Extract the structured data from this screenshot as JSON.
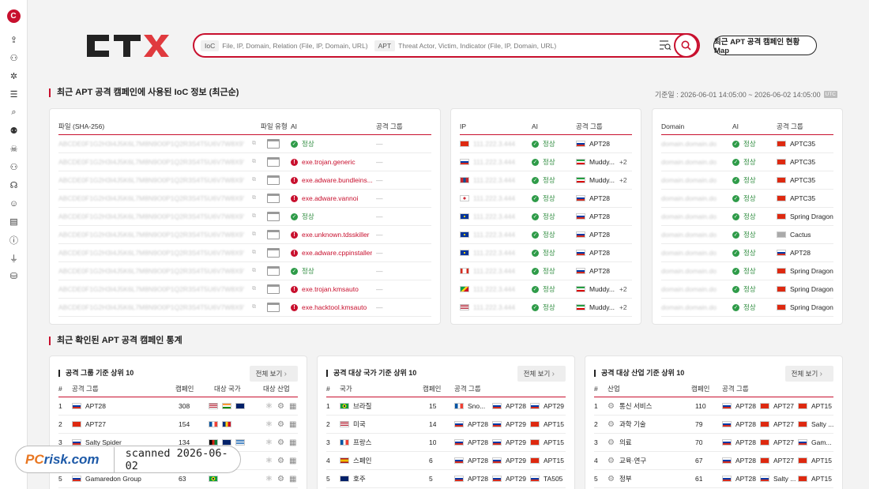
{
  "sidebar": {
    "logo": "C",
    "icons": [
      "upload-icon",
      "user-add-icon",
      "bug-icon",
      "report-icon",
      "file-search-icon",
      "virus-search-icon",
      "hacker-icon",
      "group-icon",
      "headset-icon",
      "smile-icon",
      "notes-icon",
      "info-icon",
      "plug-icon",
      "database-icon"
    ]
  },
  "header": {
    "logo": "CTX",
    "search": {
      "ioc_tag": "IoC",
      "ioc_placeholder": "File, IP, Domain, Relation (File, IP, Domain, URL)",
      "apt_tag": "APT",
      "apt_placeholder": "Threat Actor, Victim, Indicator (File, IP, Domain, URL)"
    },
    "map_button": "최근 APT 공격 캠페인 현황 Map"
  },
  "ioc_section": {
    "title": "최근 APT 공격 캠페인에 사용된 IoC 정보 (최근순)",
    "basis_label": "기준일 :",
    "basis_range": "2026-06-01 14:05:00 ~ 2026-06-02 14:05:00",
    "utc": "UTC",
    "file_table": {
      "headers": {
        "file": "파일 (SHA-256)",
        "type": "파일 유형",
        "ai": "AI",
        "group": "공격 그룹"
      },
      "rows": [
        {
          "hash": "ABCDE0F1G2H3I4J5K6L7M8N9O0P1Q2R3S4T5U6V7W8X9Y0Z1A2",
          "ai": "정상",
          "status": "ok",
          "group": "—"
        },
        {
          "hash": "ABCDE0F1G2H3I4J5K6L7M8N9O0P1Q2R3S4T5U6V7W8X9Y0Z1A2",
          "ai": "exe.trojan.generic",
          "status": "bad",
          "group": "—"
        },
        {
          "hash": "ABCDE0F1G2H3I4J5K6L7M8N9O0P1Q2R3S4T5U6V7W8X9Y0Z1A2",
          "ai": "exe.adware.bundleins...",
          "status": "bad",
          "group": "—"
        },
        {
          "hash": "ABCDE0F1G2H3I4J5K6L7M8N9O0P1Q2R3S4T5U6V7W8X9Y0Z1A2",
          "ai": "exe.adware.vannoi",
          "status": "bad",
          "group": "—"
        },
        {
          "hash": "ABCDE0F1G2H3I4J5K6L7M8N9O0P1Q2R3S4T5U6V7W8X9Y0Z1A2",
          "ai": "정상",
          "status": "ok",
          "group": "—"
        },
        {
          "hash": "ABCDE0F1G2H3I4J5K6L7M8N9O0P1Q2R3S4T5U6V7W8X9Y0Z1A2",
          "ai": "exe.unknown.tdsskiller",
          "status": "bad",
          "group": "—"
        },
        {
          "hash": "ABCDE0F1G2H3I4J5K6L7M8N9O0P1Q2R3S4T5U6V7W8X9Y0Z1A2",
          "ai": "exe.adware.cppinstaller",
          "status": "bad",
          "group": "—"
        },
        {
          "hash": "ABCDE0F1G2H3I4J5K6L7M8N9O0P1Q2R3S4T5U6V7W8X9Y0Z1A2",
          "ai": "정상",
          "status": "ok",
          "group": "—"
        },
        {
          "hash": "ABCDE0F1G2H3I4J5K6L7M8N9O0P1Q2R3S4T5U6V7W8X9Y0Z1A2",
          "ai": "exe.trojan.kmsauto",
          "status": "bad",
          "group": "—"
        },
        {
          "hash": "ABCDE0F1G2H3I4J5K6L7M8N9O0P1Q2R3S4T5U6V7W8X9Y0Z1A2",
          "ai": "exe.hacktool.kmsauto",
          "status": "bad",
          "group": "—"
        }
      ]
    },
    "ip_table": {
      "headers": {
        "ip": "IP",
        "ai": "AI",
        "group": "공격 그룹"
      },
      "rows": [
        {
          "ip": "111.222.3.444",
          "flag": "cn",
          "ai": "정상",
          "group": "APT28",
          "gflag": "ru",
          "more": ""
        },
        {
          "ip": "111.222.3.444",
          "flag": "ru",
          "ai": "정상",
          "group": "Muddy...",
          "gflag": "ir",
          "more": "+2"
        },
        {
          "ip": "111.222.3.444",
          "flag": "mo",
          "ai": "정상",
          "group": "Muddy...",
          "gflag": "ir",
          "more": "+2"
        },
        {
          "ip": "111.222.3.444",
          "flag": "kr",
          "ai": "정상",
          "group": "APT28",
          "gflag": "ru",
          "more": ""
        },
        {
          "ip": "111.222.3.444",
          "flag": "eu",
          "ai": "정상",
          "group": "APT28",
          "gflag": "ru",
          "more": ""
        },
        {
          "ip": "111.222.3.444",
          "flag": "eu",
          "ai": "정상",
          "group": "APT28",
          "gflag": "ru",
          "more": ""
        },
        {
          "ip": "111.222.3.444",
          "flag": "eu",
          "ai": "정상",
          "group": "APT28",
          "gflag": "ru",
          "more": ""
        },
        {
          "ip": "111.222.3.444",
          "flag": "ca",
          "ai": "정상",
          "group": "APT28",
          "gflag": "ru",
          "more": ""
        },
        {
          "ip": "111.222.3.444",
          "flag": "gy",
          "ai": "정상",
          "group": "Muddy...",
          "gflag": "ir",
          "more": "+2"
        },
        {
          "ip": "111.222.3.444",
          "flag": "us",
          "ai": "정상",
          "group": "Muddy...",
          "gflag": "ir",
          "more": "+2"
        }
      ]
    },
    "domain_table": {
      "headers": {
        "domain": "Domain",
        "ai": "AI",
        "group": "공격 그룹"
      },
      "rows": [
        {
          "domain": "domain.domain.do",
          "ai": "정상",
          "group": "APTC35",
          "gflag": "cn"
        },
        {
          "domain": "domain.domain.do",
          "ai": "정상",
          "group": "APTC35",
          "gflag": "cn"
        },
        {
          "domain": "domain.domain.do",
          "ai": "정상",
          "group": "APTC35",
          "gflag": "cn"
        },
        {
          "domain": "domain.domain.do",
          "ai": "정상",
          "group": "APTC35",
          "gflag": "cn"
        },
        {
          "domain": "domain.domain.do",
          "ai": "정상",
          "group": "Spring Dragon",
          "gflag": "cn"
        },
        {
          "domain": "domain.domain.do",
          "ai": "정상",
          "group": "Cactus",
          "gflag": "un"
        },
        {
          "domain": "domain.domain.do",
          "ai": "정상",
          "group": "APT28",
          "gflag": "ru"
        },
        {
          "domain": "domain.domain.do",
          "ai": "정상",
          "group": "Spring Dragon",
          "gflag": "cn"
        },
        {
          "domain": "domain.domain.do",
          "ai": "정상",
          "group": "Spring Dragon",
          "gflag": "cn"
        },
        {
          "domain": "domain.domain.do",
          "ai": "정상",
          "group": "Spring Dragon",
          "gflag": "cn"
        }
      ]
    }
  },
  "stats_section": {
    "title": "최근 확인된 APT 공격 캠페인 통계",
    "view_all": "전체 보기",
    "group_top": {
      "title": "공격 그룹 기준 상위 10",
      "headers": {
        "num": "#",
        "group": "공격 그룹",
        "campaign": "캠페인",
        "country": "대상 국가",
        "industry": "대상 산업"
      },
      "rows": [
        {
          "num": "1",
          "group": "APT28",
          "flag": "ru",
          "count": "308",
          "countries": [
            "us",
            "in",
            "au"
          ]
        },
        {
          "num": "2",
          "group": "APT27",
          "flag": "cn",
          "count": "154",
          "countries": [
            "fr",
            "ro"
          ]
        },
        {
          "num": "3",
          "group": "Salty Spider",
          "flag": "ru",
          "count": "134",
          "countries": [
            "af",
            "gb",
            "gr"
          ]
        },
        {
          "num": "4",
          "group": "",
          "flag": "",
          "count": "",
          "countries": [
            "cn"
          ]
        },
        {
          "num": "5",
          "group": "Gamaredon Group",
          "flag": "ru",
          "count": "63",
          "countries": [
            "br"
          ]
        }
      ]
    },
    "country_top": {
      "title": "공격 대상 국가 기준 상위 10",
      "headers": {
        "num": "#",
        "country": "국가",
        "campaign": "캠페인",
        "group": "공격 그룹"
      },
      "rows": [
        {
          "num": "1",
          "country": "브라질",
          "flag": "br",
          "count": "15",
          "groups": [
            {
              "n": "Sno...",
              "f": "fr"
            },
            {
              "n": "APT28",
              "f": "ru"
            },
            {
              "n": "APT29",
              "f": "ru"
            }
          ]
        },
        {
          "num": "2",
          "country": "미국",
          "flag": "us",
          "count": "14",
          "groups": [
            {
              "n": "APT28",
              "f": "ru"
            },
            {
              "n": "APT29",
              "f": "ru"
            },
            {
              "n": "APT15",
              "f": "cn"
            }
          ]
        },
        {
          "num": "3",
          "country": "프랑스",
          "flag": "fr",
          "count": "10",
          "groups": [
            {
              "n": "APT28",
              "f": "ru"
            },
            {
              "n": "APT29",
              "f": "ru"
            },
            {
              "n": "APT15",
              "f": "cn"
            }
          ]
        },
        {
          "num": "4",
          "country": "스페인",
          "flag": "es",
          "count": "6",
          "groups": [
            {
              "n": "APT28",
              "f": "ru"
            },
            {
              "n": "APT29",
              "f": "ru"
            },
            {
              "n": "APT15",
              "f": "cn"
            }
          ]
        },
        {
          "num": "5",
          "country": "호주",
          "flag": "au",
          "count": "5",
          "groups": [
            {
              "n": "APT28",
              "f": "ru"
            },
            {
              "n": "APT29",
              "f": "ru"
            },
            {
              "n": "TA505",
              "f": "ru"
            }
          ]
        }
      ]
    },
    "industry_top": {
      "title": "공격 대상 산업 기준 상위 10",
      "headers": {
        "num": "#",
        "industry": "산업",
        "campaign": "캠페인",
        "group": "공격 그룹"
      },
      "rows": [
        {
          "num": "1",
          "industry": "통신 서비스",
          "count": "110",
          "groups": [
            {
              "n": "APT28",
              "f": "ru"
            },
            {
              "n": "APT27",
              "f": "cn"
            },
            {
              "n": "APT15",
              "f": "cn"
            }
          ]
        },
        {
          "num": "2",
          "industry": "과학 기술",
          "count": "79",
          "groups": [
            {
              "n": "APT28",
              "f": "ru"
            },
            {
              "n": "APT27",
              "f": "cn"
            },
            {
              "n": "Salty ...",
              "f": "cn"
            }
          ]
        },
        {
          "num": "3",
          "industry": "의료",
          "count": "70",
          "groups": [
            {
              "n": "APT28",
              "f": "ru"
            },
            {
              "n": "APT27",
              "f": "cn"
            },
            {
              "n": "Gam...",
              "f": "ru"
            }
          ]
        },
        {
          "num": "4",
          "industry": "교육·연구",
          "count": "67",
          "groups": [
            {
              "n": "APT28",
              "f": "ru"
            },
            {
              "n": "APT27",
              "f": "cn"
            },
            {
              "n": "APT15",
              "f": "cn"
            }
          ]
        },
        {
          "num": "5",
          "industry": "정부",
          "count": "61",
          "groups": [
            {
              "n": "APT28",
              "f": "ru"
            },
            {
              "n": "Salty ...",
              "f": "ru"
            },
            {
              "n": "APT15",
              "f": "cn"
            }
          ]
        }
      ]
    }
  },
  "watermark": {
    "logo_pc": "PC",
    "logo_rest": "risk.com",
    "text": "scanned 2026-06-02"
  },
  "colors": {
    "accent": "#c8102e",
    "ok": "#2e8b3e"
  }
}
